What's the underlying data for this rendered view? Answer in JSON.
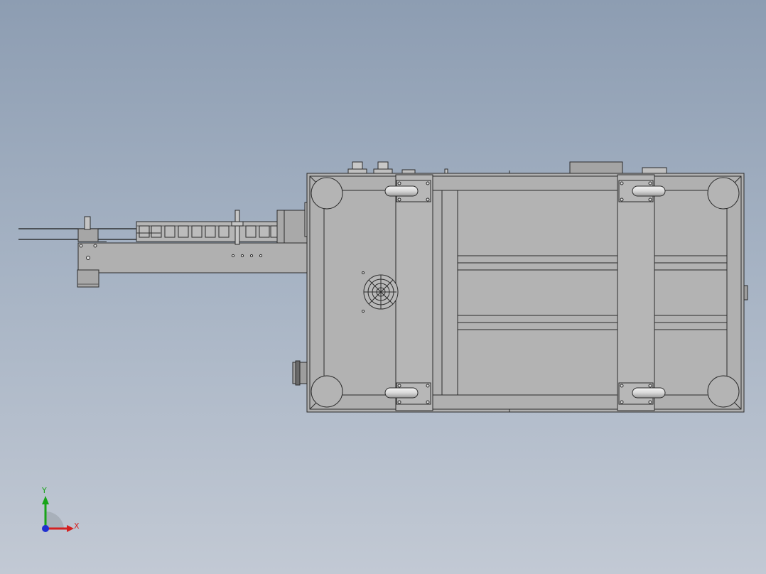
{
  "viewport": {
    "background_top": "#8d9db2",
    "background_bottom": "#c2c9d4"
  },
  "model": {
    "body_fill": "#b0b0b0",
    "edge_color": "#2b2b2b",
    "caster_fill": "#e6e6e6"
  },
  "triad": {
    "x_label": "X",
    "y_label": "Y",
    "x_color": "#d42020",
    "y_color": "#18a418",
    "z_color": "#1f2fd0"
  }
}
